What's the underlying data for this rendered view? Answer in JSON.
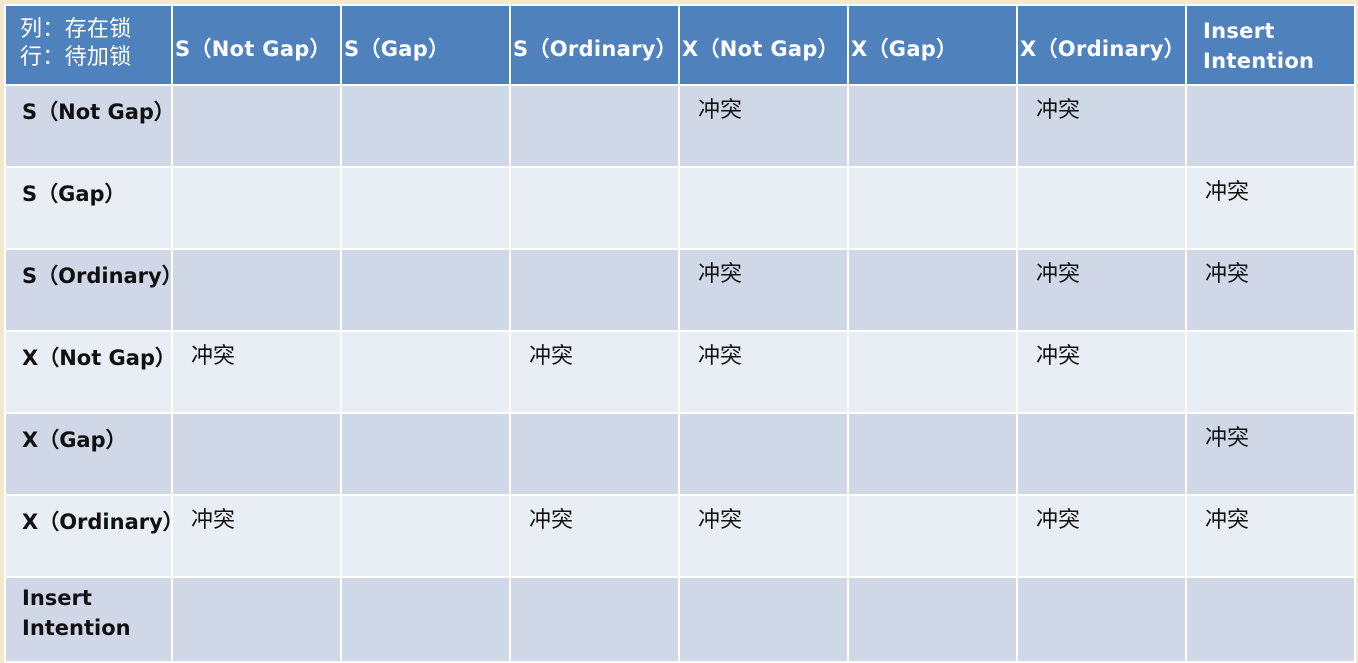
{
  "corner": {
    "line1": "列：存在锁",
    "line2": "行：待加锁"
  },
  "columns": [
    "S（Not Gap）",
    "S（Gap）",
    "S（Ordinary）",
    "X（Not Gap）",
    "X（Gap）",
    "X（Ordinary）",
    "Insert Intention"
  ],
  "rows": [
    {
      "label": "S（Not Gap）",
      "cells": [
        "",
        "",
        "",
        "冲突",
        "",
        "冲突",
        ""
      ]
    },
    {
      "label": "S（Gap）",
      "cells": [
        "",
        "",
        "",
        "",
        "",
        "",
        "冲突"
      ]
    },
    {
      "label": "S（Ordinary）",
      "cells": [
        "",
        "",
        "",
        "冲突",
        "",
        "冲突",
        "冲突"
      ]
    },
    {
      "label": "X（Not Gap）",
      "cells": [
        "冲突",
        "",
        "冲突",
        "冲突",
        "",
        "冲突",
        ""
      ]
    },
    {
      "label": "X（Gap）",
      "cells": [
        "",
        "",
        "",
        "",
        "",
        "",
        "冲突"
      ]
    },
    {
      "label": "X（Ordinary）",
      "cells": [
        "冲突",
        "",
        "冲突",
        "冲突",
        "",
        "冲突",
        "冲突"
      ]
    },
    {
      "label": "Insert Intention",
      "cells": [
        "",
        "",
        "",
        "",
        "",
        "",
        ""
      ]
    }
  ],
  "colors": {
    "header_bg": "#4f81bd",
    "row_dark": "#d0d8e8",
    "row_light": "#e9edf4",
    "background": "#f3e8cb"
  }
}
